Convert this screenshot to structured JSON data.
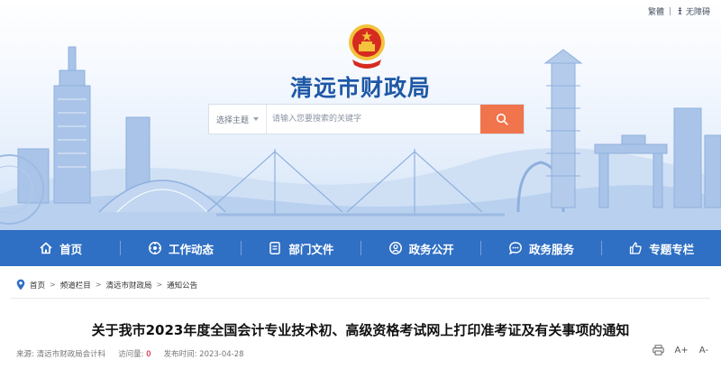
{
  "header": {
    "traditional_label": "繁體",
    "accessibility_label": "无障碍",
    "site_title": "清远市财政局"
  },
  "search": {
    "scope_label": "选择主题",
    "placeholder": "请输入您要搜索的关键字"
  },
  "nav": {
    "items": [
      {
        "label": "首页",
        "icon": "home-icon"
      },
      {
        "label": "工作动态",
        "icon": "work-icon"
      },
      {
        "label": "部门文件",
        "icon": "document-icon"
      },
      {
        "label": "政务公开",
        "icon": "people-icon"
      },
      {
        "label": "政务服务",
        "icon": "chat-icon"
      },
      {
        "label": "专题专栏",
        "icon": "thumb-up-icon"
      }
    ]
  },
  "breadcrumb": {
    "items": [
      "首页",
      "频道栏目",
      "清远市财政局",
      "通知公告"
    ]
  },
  "article": {
    "title": "关于我市2023年度全国会计专业技术初、高级资格考试网上打印准考证及有关事项的通知",
    "source_label": "来源:",
    "source": "清远市财政局会计科",
    "views_label": "访问量:",
    "views": "0",
    "date_label": "发布时间:",
    "date": "2023-04-28"
  },
  "tools": {
    "print_icon": "print-icon",
    "font_up_label": "A+",
    "font_down_label": "A-"
  },
  "colors": {
    "brand_blue": "#2f6fc4",
    "title_blue": "#1e58a6",
    "search_button": "#f0744c",
    "emblem_red": "#d62b20",
    "emblem_gold": "#f3c33b",
    "views_highlight": "#d0021b"
  }
}
